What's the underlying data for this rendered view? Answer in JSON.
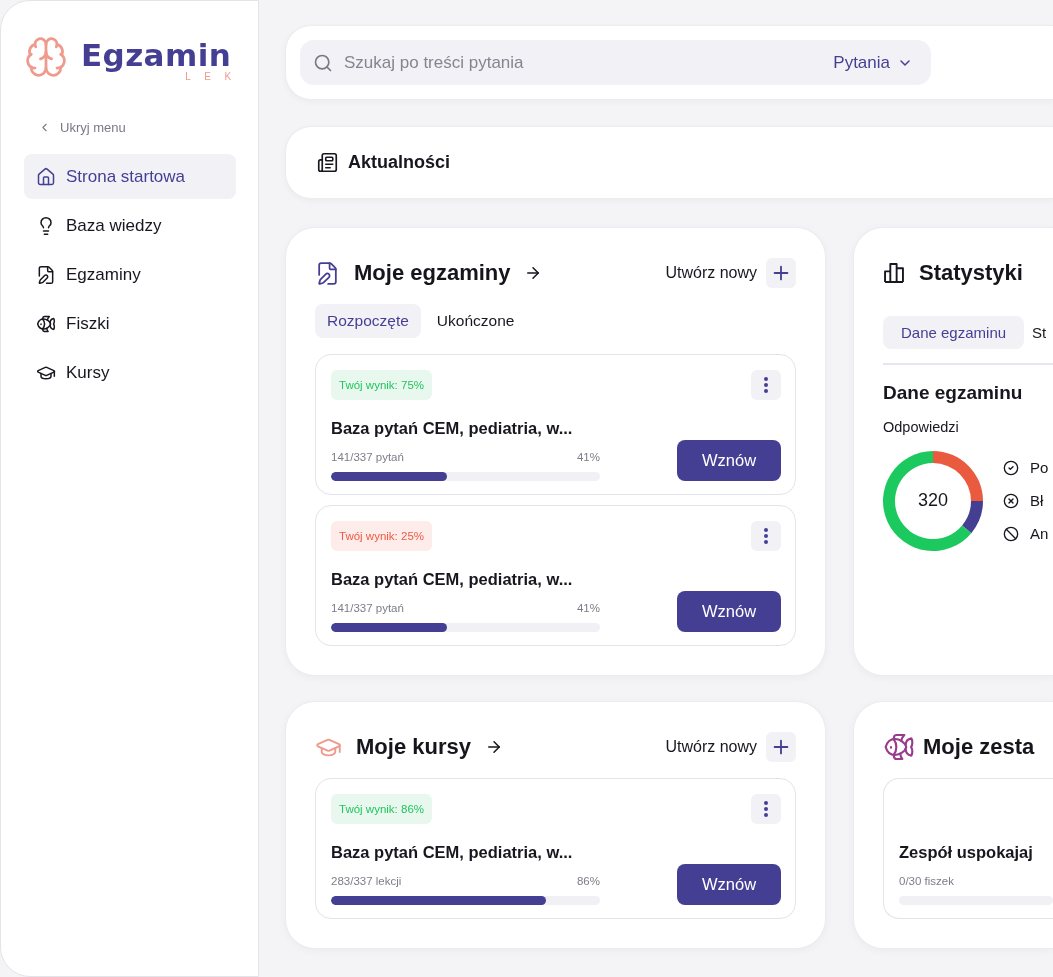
{
  "sidebar": {
    "logo": {
      "title": "Egzamin",
      "subtitle": "LEK"
    },
    "collapse_label": "Ukryj menu",
    "items": [
      {
        "label": "Strona startowa",
        "selected": true
      },
      {
        "label": "Baza wiedzy",
        "selected": false
      },
      {
        "label": "Egzaminy",
        "selected": false
      },
      {
        "label": "Fiszki",
        "selected": false
      },
      {
        "label": "Kursy",
        "selected": false
      }
    ]
  },
  "search": {
    "placeholder": "Szukaj po treści pytania",
    "scope": "Pytania"
  },
  "news": {
    "title": "Aktualności"
  },
  "exams": {
    "title": "Moje egzaminy",
    "create_label": "Utwórz nowy",
    "tabs": [
      {
        "label": "Rozpoczęte",
        "selected": true
      },
      {
        "label": "Ukończone",
        "selected": false
      }
    ],
    "items": [
      {
        "score": "Twój wynik: 75%",
        "passed": true,
        "title": "Baza pytań CEM, pediatria, w...",
        "progress": "141/337 pytań",
        "percent": "41%",
        "level": 0.43,
        "action": "Wznów"
      },
      {
        "score": "Twój wynik: 25%",
        "passed": false,
        "title": "Baza pytań CEM, pediatria, w...",
        "progress": "141/337 pytań",
        "percent": "41%",
        "level": 0.43,
        "action": "Wznów"
      }
    ]
  },
  "stats": {
    "title": "Statystyki",
    "tabs": [
      {
        "label": "Dane egzaminu",
        "selected": true
      },
      {
        "label": "St",
        "selected": false
      }
    ],
    "heading": "Dane egzaminu",
    "subheading": "Odpowiedzi",
    "total": "320",
    "legend": [
      "Po",
      "Bł",
      "An"
    ]
  },
  "courses": {
    "title": "Moje kursy",
    "create_label": "Utwórz nowy",
    "items": [
      {
        "score": "Twój wynik: 86%",
        "passed": true,
        "title": "Baza pytań CEM, pediatria, w...",
        "progress": "283/337 lekcji",
        "percent": "86%",
        "level": 0.8,
        "action": "Wznów"
      }
    ]
  },
  "flashcards": {
    "title": "Moje zesta",
    "items": [
      {
        "title": "Zespół uspokajaj",
        "progress": "0/30 fiszek"
      }
    ]
  }
}
